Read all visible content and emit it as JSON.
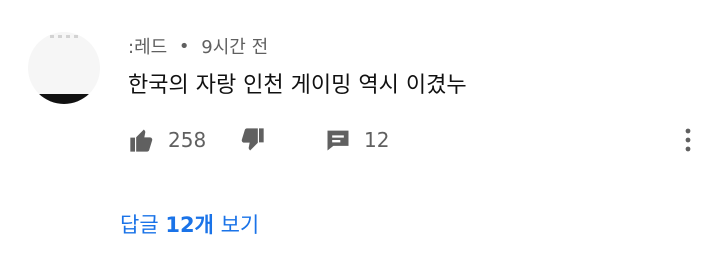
{
  "comment": {
    "author": ":레드",
    "time_ago": "9시간 전",
    "separator": "•",
    "text": "한국의 자랑 인천 게이밍 역시 이겼누",
    "likes": "258",
    "replies_count": "12"
  },
  "actions": {
    "like_icon": "thumb-up-icon",
    "dislike_icon": "thumb-down-icon",
    "reply_icon": "reply-comment-icon",
    "more_icon": "more-vertical-icon"
  },
  "replies_link": {
    "prefix": "답글",
    "count": "12개",
    "suffix": "보기"
  },
  "colors": {
    "background": "#ffffff",
    "primary_text": "#111111",
    "secondary_text": "#606060",
    "link": "#1a73e8"
  }
}
